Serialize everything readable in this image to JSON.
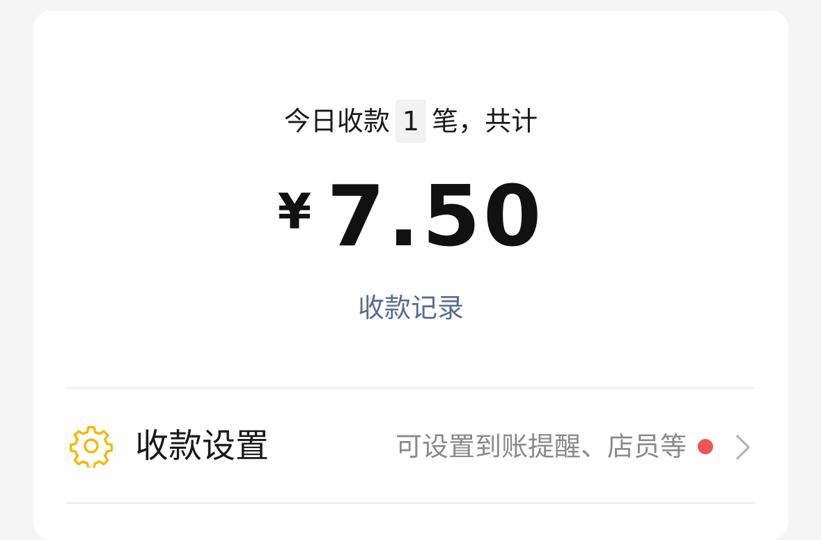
{
  "summary": {
    "prefix": "今日收款",
    "count": "1",
    "suffix": "笔，共计"
  },
  "amount": {
    "currency": "¥",
    "value": "7.50"
  },
  "records_link": "收款记录",
  "settings": {
    "label": "收款设置",
    "hint": "可设置到账提醒、店员等",
    "icon": "gear-icon",
    "has_badge": true
  },
  "colors": {
    "link": "#576b95",
    "icon": "#f5b800",
    "badge": "#f05454",
    "background": "#f5f5f5",
    "card": "#ffffff"
  }
}
